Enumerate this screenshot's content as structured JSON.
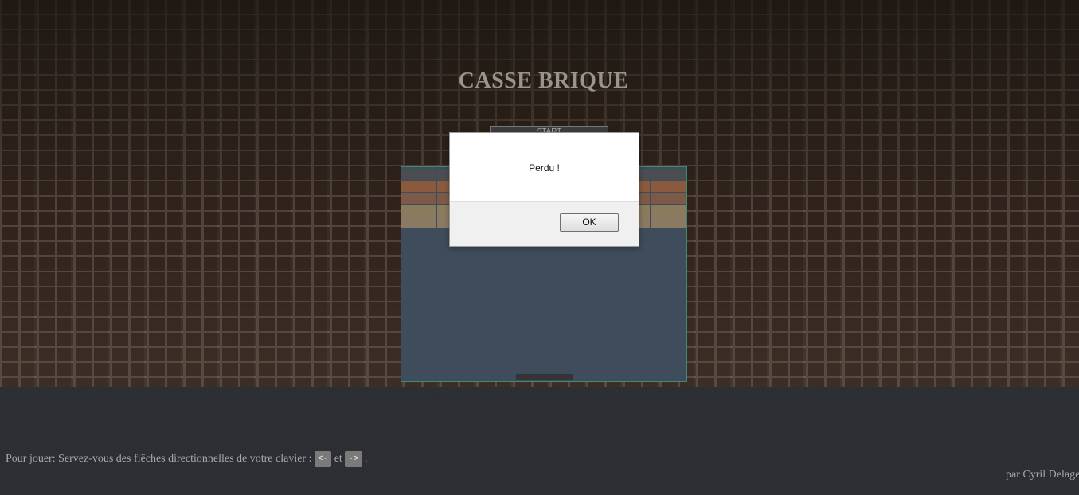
{
  "title": "CASSE BRIQUE",
  "start_button": "START",
  "board": {
    "colors": {
      "background": "#3e4c5b",
      "border": "#3f8a70",
      "paddle": "#333338"
    },
    "brick_rows": [
      {
        "color": "#4a4e52"
      },
      {
        "color": "#8a5a3e"
      },
      {
        "color": "#7d5a48"
      },
      {
        "color": "#8a7a5e"
      },
      {
        "color": "#8a7a62"
      }
    ],
    "bricks_per_row": 8
  },
  "dialog": {
    "message": "Perdu !",
    "ok_label": "OK"
  },
  "instructions": {
    "text": "Pour jouer: Servez-vous des flêches directionnelles de votre clavier :",
    "left_key": "<-",
    "conjunction": "et",
    "right_key": "->",
    "end": "."
  },
  "author": "par Cyril Delage"
}
